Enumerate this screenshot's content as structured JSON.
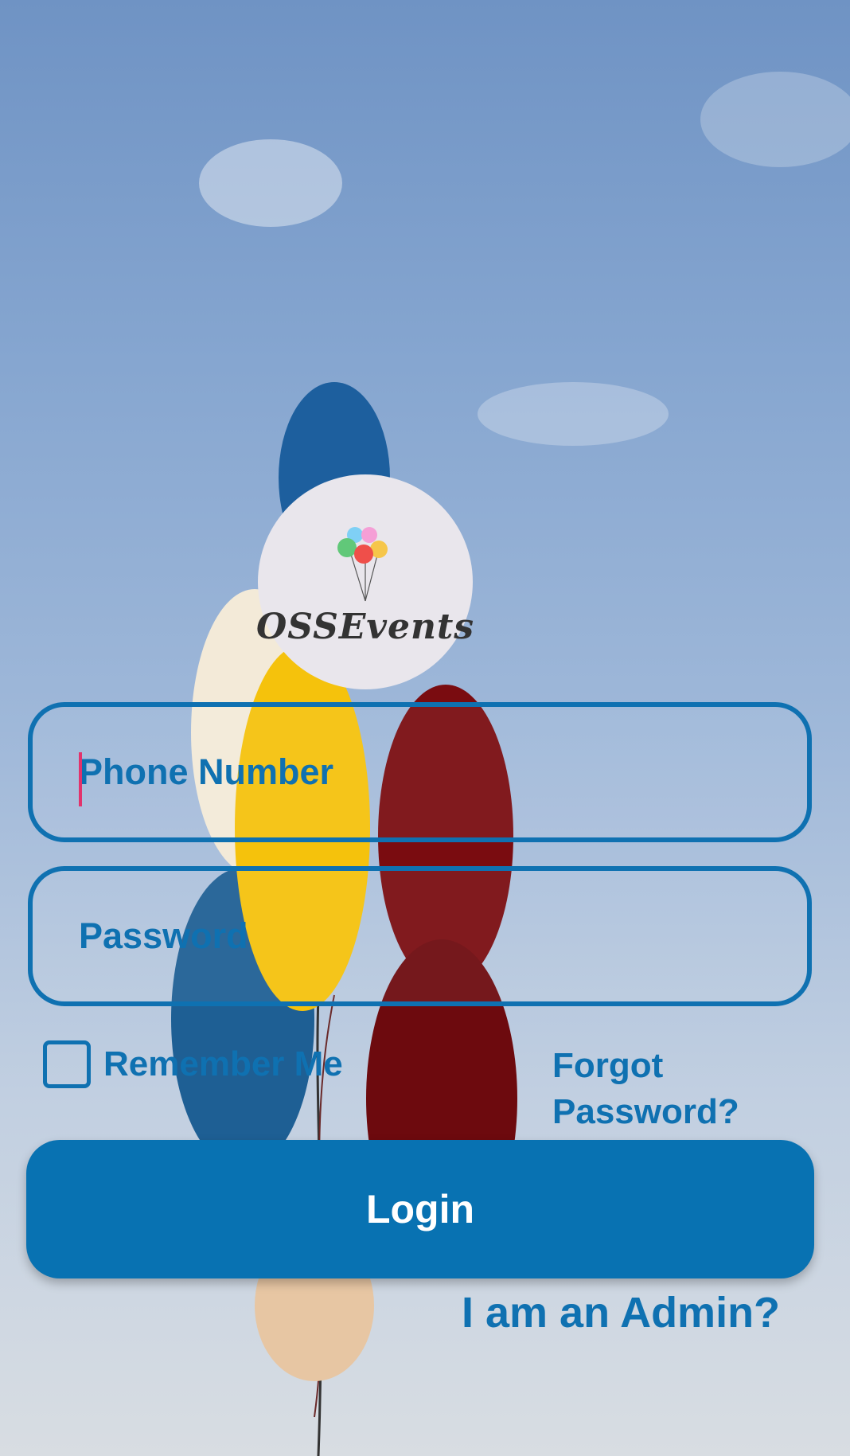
{
  "app": {
    "logo_text": "OSSEvents"
  },
  "form": {
    "phone_placeholder": "Phone Number",
    "password_placeholder": "Password",
    "remember_label": "Remember Me",
    "remember_checked": false,
    "forgot_label": "Forgot Password?",
    "login_label": "Login",
    "admin_link": "I am an Admin?"
  },
  "colors": {
    "accent": "#0f71b1",
    "button": "#0872b2",
    "caret": "#e2336c"
  }
}
